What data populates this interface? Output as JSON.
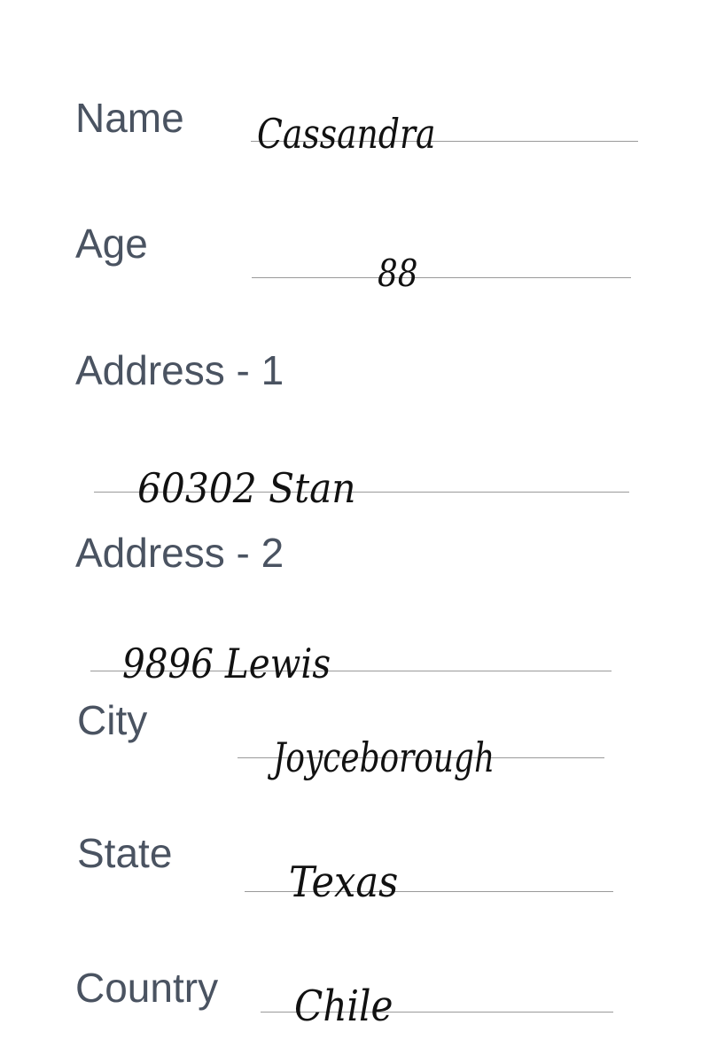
{
  "form": {
    "name": {
      "label": "Name",
      "value": "Cassandra"
    },
    "age": {
      "label": "Age",
      "value": "88"
    },
    "address1": {
      "label": "Address - 1",
      "value": "60302 Stan"
    },
    "address2": {
      "label": "Address - 2",
      "value": "9896 Lewis"
    },
    "city": {
      "label": "City",
      "value": "Joyceborough"
    },
    "state": {
      "label": "State",
      "value": "Texas"
    },
    "country": {
      "label": "Country",
      "value": "Chile"
    }
  }
}
